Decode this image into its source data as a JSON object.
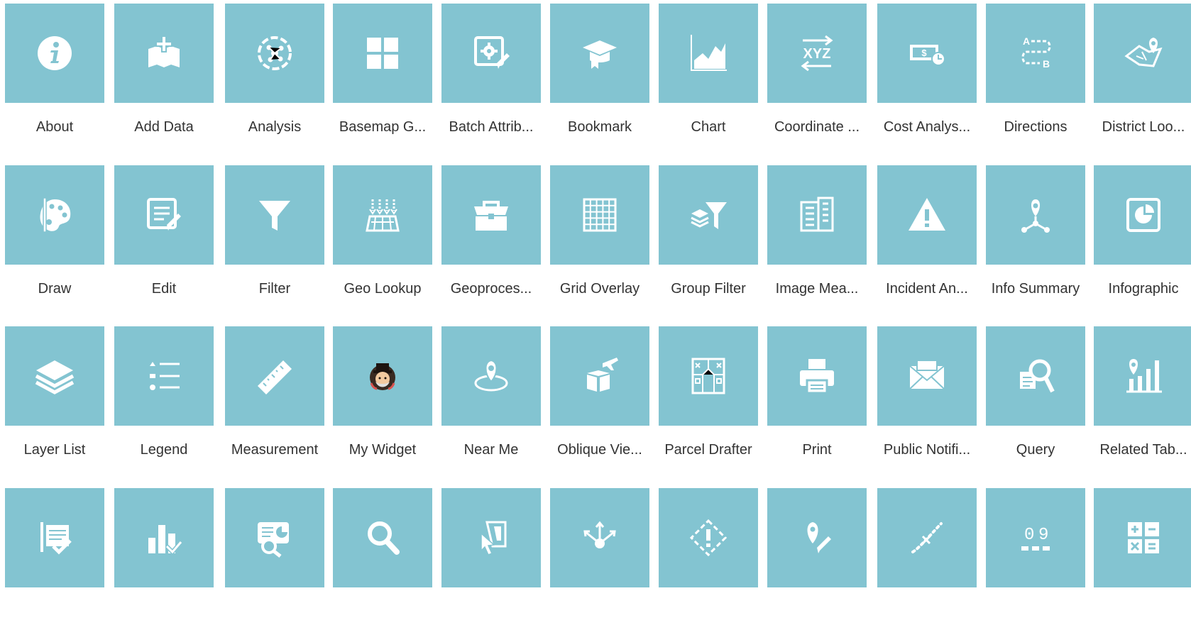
{
  "colors": {
    "tile": "#83c4d1",
    "icon": "#ffffff",
    "label": "#333333"
  },
  "widgets": [
    {
      "label": "About",
      "icon": "info-icon"
    },
    {
      "label": "Add Data",
      "icon": "add-data-icon"
    },
    {
      "label": "Analysis",
      "icon": "analysis-icon"
    },
    {
      "label": "Basemap G...",
      "icon": "basemap-gallery-icon"
    },
    {
      "label": "Batch Attrib...",
      "icon": "batch-attribute-icon"
    },
    {
      "label": "Bookmark",
      "icon": "bookmark-icon"
    },
    {
      "label": "Chart",
      "icon": "chart-icon"
    },
    {
      "label": "Coordinate ...",
      "icon": "coordinate-icon"
    },
    {
      "label": "Cost Analys...",
      "icon": "cost-analysis-icon"
    },
    {
      "label": "Directions",
      "icon": "directions-icon"
    },
    {
      "label": "District Loo...",
      "icon": "district-lookup-icon"
    },
    {
      "label": "Draw",
      "icon": "palette-icon"
    },
    {
      "label": "Edit",
      "icon": "edit-icon"
    },
    {
      "label": "Filter",
      "icon": "filter-icon"
    },
    {
      "label": "Geo Lookup",
      "icon": "geo-lookup-icon"
    },
    {
      "label": "Geoproces...",
      "icon": "toolbox-icon"
    },
    {
      "label": "Grid Overlay",
      "icon": "grid-overlay-icon"
    },
    {
      "label": "Group Filter",
      "icon": "group-filter-icon"
    },
    {
      "label": "Image Mea...",
      "icon": "image-measurement-icon"
    },
    {
      "label": "Incident An...",
      "icon": "warning-icon"
    },
    {
      "label": "Info Summary",
      "icon": "info-summary-icon"
    },
    {
      "label": "Infographic",
      "icon": "infographic-icon"
    },
    {
      "label": "Layer List",
      "icon": "layers-icon"
    },
    {
      "label": "Legend",
      "icon": "legend-icon"
    },
    {
      "label": "Measurement",
      "icon": "ruler-icon"
    },
    {
      "label": "My Widget",
      "icon": "my-widget-avatar-icon"
    },
    {
      "label": "Near Me",
      "icon": "near-me-icon"
    },
    {
      "label": "Oblique Vie...",
      "icon": "oblique-viewer-icon"
    },
    {
      "label": "Parcel Drafter",
      "icon": "parcel-drafter-icon"
    },
    {
      "label": "Print",
      "icon": "printer-icon"
    },
    {
      "label": "Public Notifi...",
      "icon": "envelope-icon"
    },
    {
      "label": "Query",
      "icon": "query-icon"
    },
    {
      "label": "Related Tab...",
      "icon": "related-table-icon"
    },
    {
      "label": "",
      "icon": "report-icon"
    },
    {
      "label": "",
      "icon": "bar-chart-check-icon"
    },
    {
      "label": "",
      "icon": "screening-icon"
    },
    {
      "label": "",
      "icon": "search-icon"
    },
    {
      "label": "",
      "icon": "select-icon"
    },
    {
      "label": "",
      "icon": "share-icon"
    },
    {
      "label": "",
      "icon": "smart-editor-icon"
    },
    {
      "label": "",
      "icon": "situation-awareness-icon"
    },
    {
      "label": "",
      "icon": "swipe-icon"
    },
    {
      "label": "",
      "icon": "summary-icon"
    },
    {
      "label": "",
      "icon": "calculator-icon"
    }
  ]
}
